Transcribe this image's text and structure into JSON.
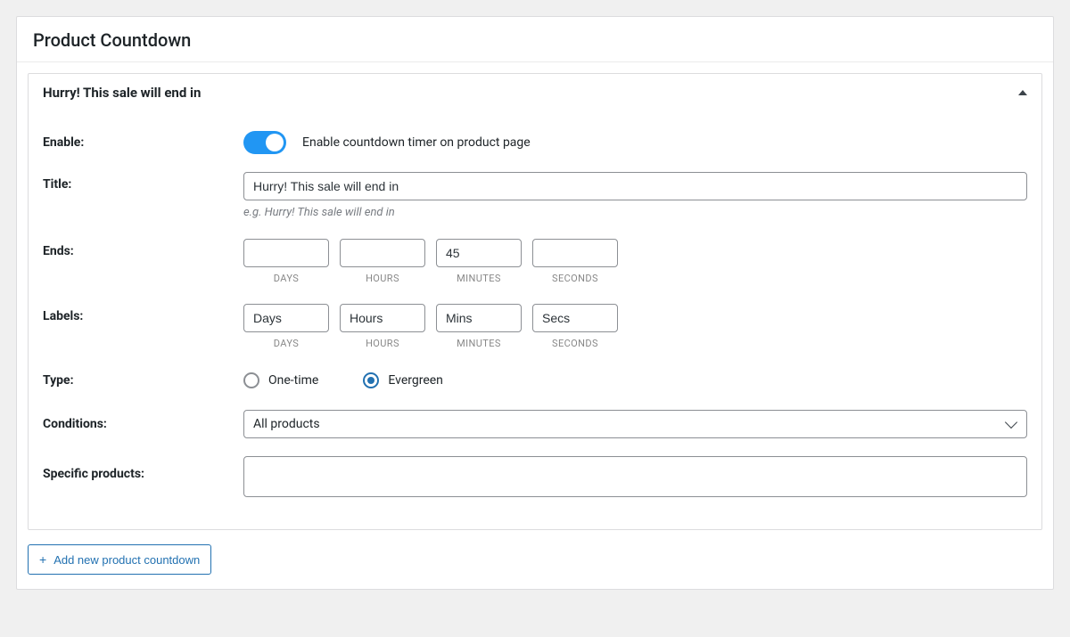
{
  "panel": {
    "title": "Product Countdown"
  },
  "item": {
    "header": "Hurry! This sale will end in"
  },
  "fields": {
    "enable": {
      "label": "Enable:",
      "description": "Enable countdown timer on product page",
      "value": true
    },
    "title": {
      "label": "Title:",
      "value": "Hurry! This sale will end in",
      "hint": "e.g. Hurry! This sale will end in"
    },
    "ends": {
      "label": "Ends:",
      "days": "",
      "hours": "",
      "minutes": "45",
      "seconds": "",
      "sub": {
        "days": "DAYS",
        "hours": "HOURS",
        "minutes": "MINUTES",
        "seconds": "SECONDS"
      }
    },
    "labels": {
      "label": "Labels:",
      "days": "Days",
      "hours": "Hours",
      "minutes": "Mins",
      "seconds": "Secs",
      "sub": {
        "days": "DAYS",
        "hours": "HOURS",
        "minutes": "MINUTES",
        "seconds": "SECONDS"
      }
    },
    "type": {
      "label": "Type:",
      "options": {
        "one_time": "One-time",
        "evergreen": "Evergreen"
      },
      "selected": "evergreen"
    },
    "conditions": {
      "label": "Conditions:",
      "selected": "All products"
    },
    "specific": {
      "label": "Specific products:"
    }
  },
  "actions": {
    "add_new": "Add new product countdown"
  }
}
